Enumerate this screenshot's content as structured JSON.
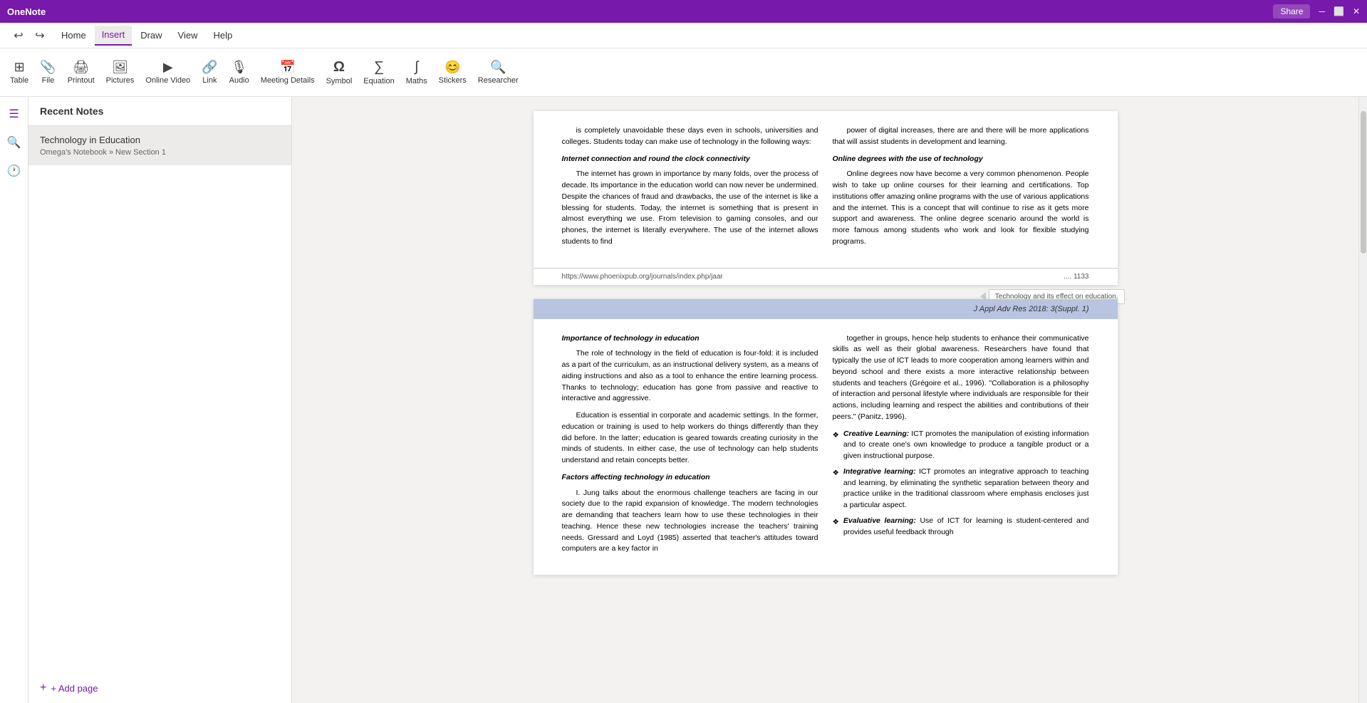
{
  "app": {
    "title": "OneNote"
  },
  "menu": {
    "items": [
      {
        "label": "Home",
        "active": false
      },
      {
        "label": "Insert",
        "active": true
      },
      {
        "label": "Draw",
        "active": false
      },
      {
        "label": "View",
        "active": false
      },
      {
        "label": "Help",
        "active": false
      }
    ]
  },
  "ribbon": {
    "buttons": [
      {
        "label": "Table",
        "icon": "⊞"
      },
      {
        "label": "File",
        "icon": "📎"
      },
      {
        "label": "Printout",
        "icon": "🖨"
      },
      {
        "label": "Pictures",
        "icon": "🖼"
      },
      {
        "label": "Online Video",
        "icon": "▶"
      },
      {
        "label": "Link",
        "icon": "🔗"
      },
      {
        "label": "Audio",
        "icon": "🎙"
      },
      {
        "label": "Meeting Details",
        "icon": "📅"
      },
      {
        "label": "Symbol",
        "icon": "Ω"
      },
      {
        "label": "Equation",
        "icon": "∑"
      },
      {
        "label": "Maths",
        "icon": "∫"
      },
      {
        "label": "Stickers",
        "icon": "😊"
      },
      {
        "label": "Researcher",
        "icon": "🔍"
      }
    ]
  },
  "sidebar": {
    "icons": [
      {
        "name": "pages-icon",
        "symbol": "☰"
      },
      {
        "name": "search-icon",
        "symbol": "🔍"
      },
      {
        "name": "history-icon",
        "symbol": "🕐"
      }
    ]
  },
  "notes_panel": {
    "header": "Recent Notes",
    "items": [
      {
        "title": "Technology in Education",
        "subtitle": "Omega's Notebook » New Section 1"
      }
    ],
    "add_page_label": "+ Add page"
  },
  "page1": {
    "col1": {
      "para1": "is completely unavoidable these days even in schools, universities and colleges. Students today can make use of technology in the following ways:",
      "heading1": "Internet connection and round the clock connectivity",
      "para2": "The internet has grown in importance by many folds, over the process of decade. Its importance in the education world can now never be undermined. Despite the chances of fraud and drawbacks, the use of the internet is like a blessing for students. Today, the internet is something that is present in almost everything we use. From television to gaming consoles, and our phones, the internet is literally everywhere. The use of the internet allows students to find"
    },
    "col2": {
      "para1": "power of digital increases, there are and there will be more applications that will assist students in development and learning.",
      "heading1": "Online degrees with the use of technology",
      "para2": "Online degrees now have become a very common phenomenon. People wish to take up online courses for their learning and certifications. Top institutions offer amazing online programs with the use of various applications and the internet. This is a concept that will continue to rise as it gets more support and awareness. The online degree scenario around the world is more famous among students who work and look for flexible studying programs."
    },
    "footer": {
      "url": "https://www.phoenixpub.org/journals/index.php/jaar",
      "dots": "....          1133",
      "comment": "Technology and its effect on education."
    }
  },
  "page2": {
    "header": "J Appl Adv Res 2018: 3(Suppl. 1)",
    "col1": {
      "heading1": "Importance of technology in education",
      "para1": "The role of technology in the field of education is four-fold: it is included as a part of the curriculum, as an instructional delivery system, as a means of aiding instructions and also as a tool to enhance the entire learning process. Thanks to technology; education has gone from passive and reactive to interactive and aggressive.",
      "para2": "Education is essential in corporate and academic settings. In the former, education or training is used to help workers do things differently than they did before. In the latter; education is geared towards creating curiosity in the minds of students. In either case, the use of technology can help students understand and retain concepts better.",
      "heading2": "Factors affecting technology in education",
      "para3": "I. Jung talks about the enormous challenge teachers are facing in our society due to the rapid expansion of knowledge. The modern technologies are demanding that teachers learn how to use these technologies in their teaching. Hence these new technologies increase the teachers' training needs. Gressard and Loyd (1985) asserted that teacher's attitudes toward computers are a key factor in"
    },
    "col2": {
      "para1": "together in groups, hence help students to enhance their communicative skills as well as their global awareness. Researchers have found that typically the use of ICT leads to more cooperation among learners within and beyond school and there exists a more interactive relationship between students and teachers (Grégoire et al., 1996). \"Collaboration is a philosophy of interaction and personal lifestyle where individuals are responsible for their actions, including learning and respect the abilities and contributions of their peers.\" (Panitz, 1996).",
      "bullets": [
        {
          "title": "Creative Learning:",
          "text": "ICT promotes the manipulation of existing information and to create one's own knowledge to produce a tangible product or a given instructional purpose."
        },
        {
          "title": "Integrative learning:",
          "text": "ICT promotes an integrative approach to teaching and learning, by eliminating the synthetic separation between theory and practice unlike in the traditional classroom where emphasis encloses just a particular aspect."
        },
        {
          "title": "Evaluative learning:",
          "text": "Use of ICT for learning is student-centered and provides useful feedback through"
        }
      ]
    }
  },
  "colors": {
    "accent": "#7719aa",
    "ribbon_bg": "white",
    "sidebar_bg": "white",
    "page_bg": "white",
    "content_bg": "#f3f2f1",
    "page2_header_bg": "#b8c4e0"
  }
}
